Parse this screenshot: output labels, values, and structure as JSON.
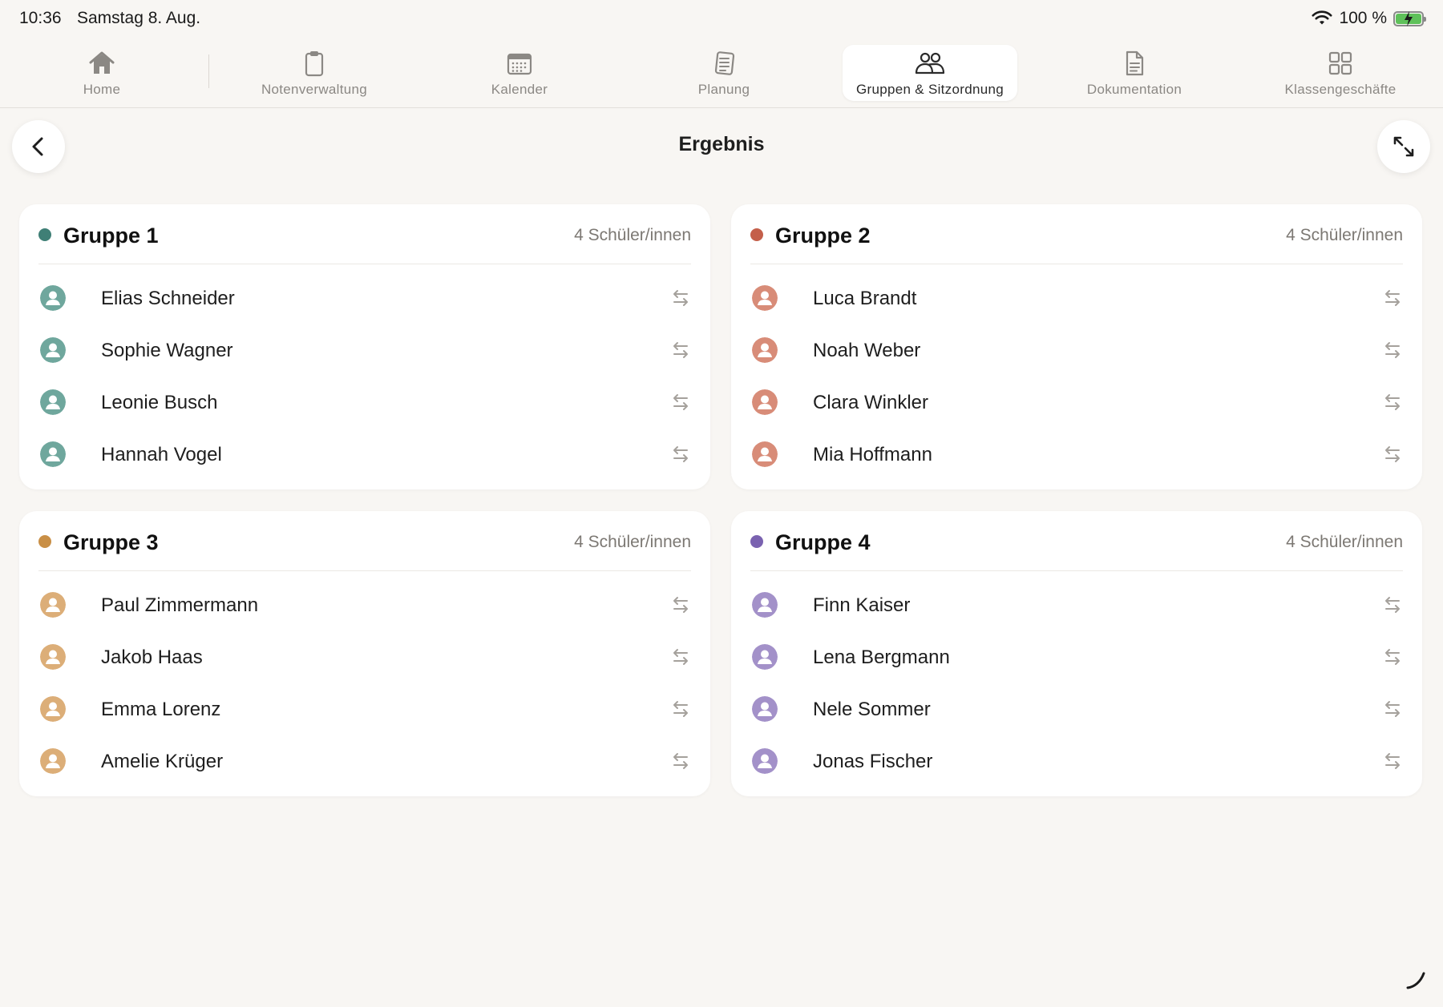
{
  "status": {
    "time": "10:36",
    "date": "Samstag 8. Aug.",
    "battery": "100 %"
  },
  "tabs": [
    {
      "label": "Home",
      "icon": "house-icon"
    },
    {
      "label": "Notenverwaltung",
      "icon": "clipboard-icon"
    },
    {
      "label": "Kalender",
      "icon": "calendar-icon"
    },
    {
      "label": "Planung",
      "icon": "notes-icon"
    },
    {
      "label": "Gruppen & Sitzordnung",
      "icon": "people-icon",
      "active": true
    },
    {
      "label": "Dokumentation",
      "icon": "document-icon"
    },
    {
      "label": "Klassengeschäfte",
      "icon": "grid-icon"
    }
  ],
  "page": {
    "title": "Ergebnis"
  },
  "groups": [
    {
      "title": "Gruppe 1",
      "count": "4 Schüler/innen",
      "color": "#3f7f76",
      "avatar_color": "#6fa79d",
      "students": [
        "Elias Schneider",
        "Sophie Wagner",
        "Leonie Busch",
        "Hannah Vogel"
      ]
    },
    {
      "title": "Gruppe 2",
      "count": "4 Schüler/innen",
      "color": "#c45f4a",
      "avatar_color": "#d88c78",
      "students": [
        "Luca Brandt",
        "Noah Weber",
        "Clara Winkler",
        "Mia Hoffmann"
      ]
    },
    {
      "title": "Gruppe 3",
      "count": "4 Schüler/innen",
      "color": "#c98f46",
      "avatar_color": "#dcae78",
      "students": [
        "Paul Zimmermann",
        "Jakob Haas",
        "Emma Lorenz",
        "Amelie Krüger"
      ]
    },
    {
      "title": "Gruppe 4",
      "count": "4 Schüler/innen",
      "color": "#7a62b0",
      "avatar_color": "#a391c9",
      "students": [
        "Finn Kaiser",
        "Lena Bergmann",
        "Nele Sommer",
        "Jonas Fischer"
      ]
    }
  ]
}
